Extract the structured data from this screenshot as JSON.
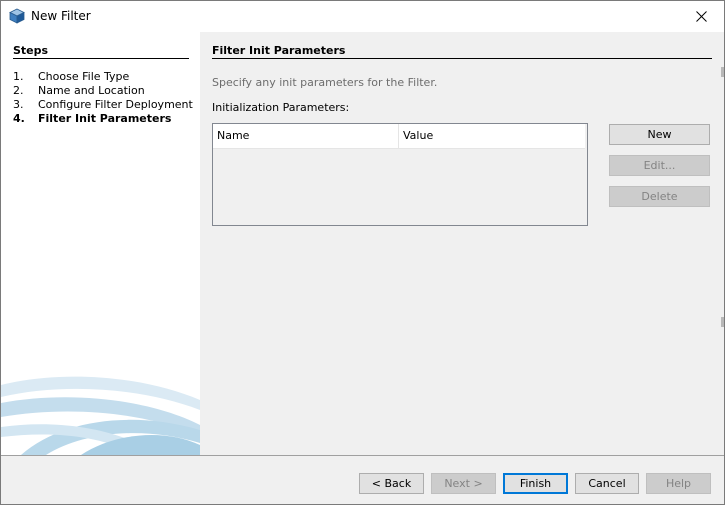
{
  "window": {
    "title": "New Filter"
  },
  "steps": {
    "title": "Steps",
    "items": [
      {
        "num": "1.",
        "label": "Choose File Type"
      },
      {
        "num": "2.",
        "label": "Name and Location"
      },
      {
        "num": "3.",
        "label": "Configure Filter Deployment"
      },
      {
        "num": "4.",
        "label": "Filter Init Parameters"
      }
    ],
    "current": 4
  },
  "main": {
    "title": "Filter Init Parameters",
    "hint": "Specify any init parameters for the Filter.",
    "params_label": "Initialization Parameters:",
    "table": {
      "columns": [
        "Name",
        "Value"
      ],
      "rows": []
    },
    "buttons": {
      "new": "New",
      "edit": "Edit...",
      "delete": "Delete"
    }
  },
  "footer": {
    "back": "< Back",
    "next": "Next >",
    "finish": "Finish",
    "cancel": "Cancel",
    "help": "Help"
  },
  "colors": {
    "accent": "#0078d7",
    "swoosh": "#b9d8ea"
  },
  "icons": {
    "app": "netbeans-cube-icon",
    "close": "close-icon"
  }
}
